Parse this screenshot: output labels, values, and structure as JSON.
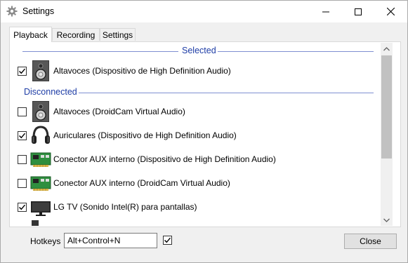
{
  "window": {
    "title": "Settings",
    "icon": "gear-icon"
  },
  "tabs": [
    {
      "label": "Playback",
      "active": true
    },
    {
      "label": "Recording",
      "active": false
    },
    {
      "label": "Settings",
      "active": false
    }
  ],
  "groups": {
    "selected": "Selected",
    "disconnected": "Disconnected"
  },
  "devices": {
    "selected": [
      {
        "label": "Altavoces (Dispositivo de High Definition Audio)",
        "checked": true,
        "icon": "speaker-icon"
      }
    ],
    "disconnected": [
      {
        "label": "Altavoces (DroidCam Virtual Audio)",
        "checked": false,
        "icon": "speaker-icon"
      },
      {
        "label": "Auriculares (Dispositivo de High Definition Audio)",
        "checked": true,
        "icon": "headphones-icon"
      },
      {
        "label": "Conector AUX interno (Dispositivo de High Definition Audio)",
        "checked": false,
        "icon": "sound-card-icon"
      },
      {
        "label": "Conector AUX interno (DroidCam Virtual Audio)",
        "checked": false,
        "icon": "sound-card-icon"
      },
      {
        "label": "LG TV (Sonido Intel(R) para pantallas)",
        "checked": true,
        "icon": "monitor-icon"
      }
    ]
  },
  "hotkeys": {
    "label": "Hotkeys",
    "value": "Alt+Control+N",
    "enabled": true
  },
  "buttons": {
    "close": "Close"
  },
  "colors": {
    "group_header": "#1e3da6",
    "group_line": "#7f8fd1",
    "scroll_thumb": "#c1c1c1"
  }
}
